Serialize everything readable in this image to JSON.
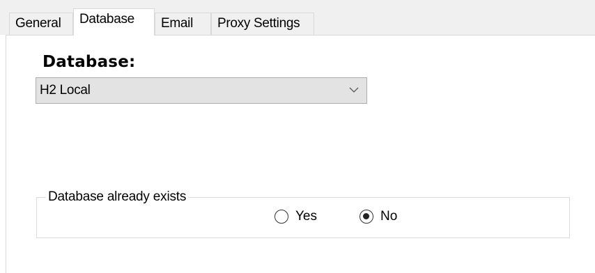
{
  "tabs": [
    {
      "label": "General",
      "selected": false
    },
    {
      "label": "Database",
      "selected": true
    },
    {
      "label": "Email",
      "selected": false
    },
    {
      "label": "Proxy Settings",
      "selected": false
    }
  ],
  "database": {
    "heading": "Database:",
    "select": {
      "value": "H2 Local",
      "icon": "chevron-down-icon"
    }
  },
  "exists_group": {
    "title": "Database already exists",
    "options": [
      {
        "label": "Yes",
        "checked": false
      },
      {
        "label": "No",
        "checked": true
      }
    ]
  }
}
